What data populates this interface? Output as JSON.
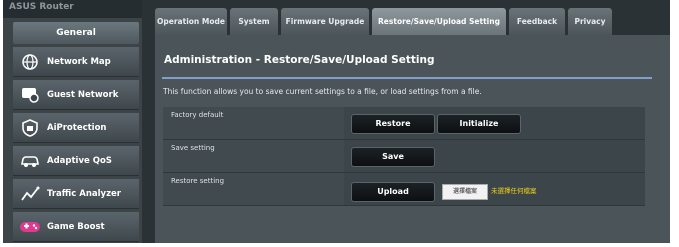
{
  "brand": "ASUS Router",
  "sidebar": {
    "section": "General",
    "items": [
      {
        "label": "Network Map",
        "icon": "globe-icon"
      },
      {
        "label": "Guest Network",
        "icon": "guest-network-icon"
      },
      {
        "label": "AiProtection",
        "icon": "shield-icon"
      },
      {
        "label": "Adaptive QoS",
        "icon": "car-icon"
      },
      {
        "label": "Traffic Analyzer",
        "icon": "traffic-analyzer-icon"
      },
      {
        "label": "Game Boost",
        "icon": "gamepad-icon"
      }
    ]
  },
  "tabs": [
    {
      "label": "Operation Mode",
      "active": false
    },
    {
      "label": "System",
      "active": false
    },
    {
      "label": "Firmware Upgrade",
      "active": false
    },
    {
      "label": "Restore/Save/Upload Setting",
      "active": true
    },
    {
      "label": "Feedback",
      "active": false
    },
    {
      "label": "Privacy",
      "active": false
    }
  ],
  "main": {
    "title": "Administration - Restore/Save/Upload Setting",
    "description": "This function allows you to save current settings to a file, or load settings from a file.",
    "rows": {
      "factory_default": {
        "label": "Factory default",
        "restore_label": "Restore",
        "initialize_label": "Initialize"
      },
      "save_setting": {
        "label": "Save setting",
        "save_label": "Save"
      },
      "restore_setting": {
        "label": "Restore setting",
        "upload_label": "Upload",
        "choose_file_label": "選擇檔案",
        "no_file_label": "未選擇任何檔案"
      }
    }
  },
  "colors": {
    "accent_divider": "#7fa0c9",
    "file_label": "#f2d21a"
  }
}
